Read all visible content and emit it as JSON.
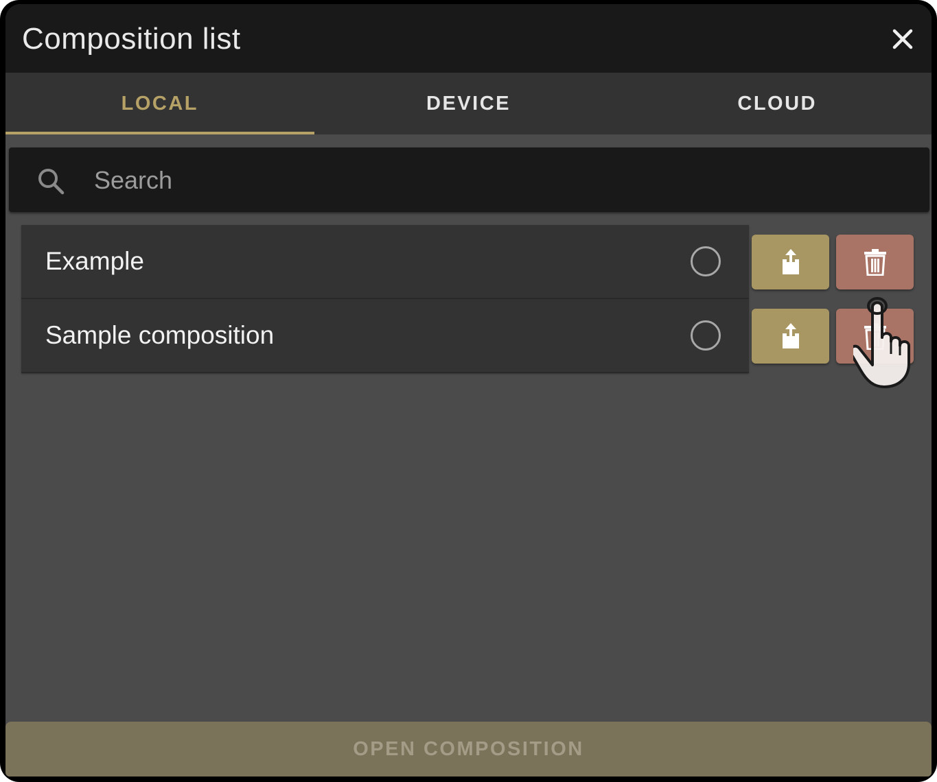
{
  "dialog": {
    "title": "Composition list",
    "close_icon": "close-icon"
  },
  "tabs": [
    {
      "label": "LOCAL",
      "active": true
    },
    {
      "label": "DEVICE",
      "active": false
    },
    {
      "label": "CLOUD",
      "active": false
    }
  ],
  "search": {
    "placeholder": "Search",
    "value": "",
    "icon": "search-icon"
  },
  "compositions": [
    {
      "name": "Example",
      "selected": false
    },
    {
      "name": "Sample composition",
      "selected": false
    }
  ],
  "actions": {
    "share_icon": "share-icon",
    "delete_icon": "trash-icon"
  },
  "footer": {
    "open_label": "OPEN COMPOSITION",
    "enabled": false
  },
  "colors": {
    "accent": "#b6a266",
    "share_button": "#a89763",
    "delete_button": "#a97466",
    "titlebar": "#191919",
    "tabs_bg": "#333333",
    "body_bg": "#4b4b4b",
    "footer_bg": "#7a7259"
  }
}
